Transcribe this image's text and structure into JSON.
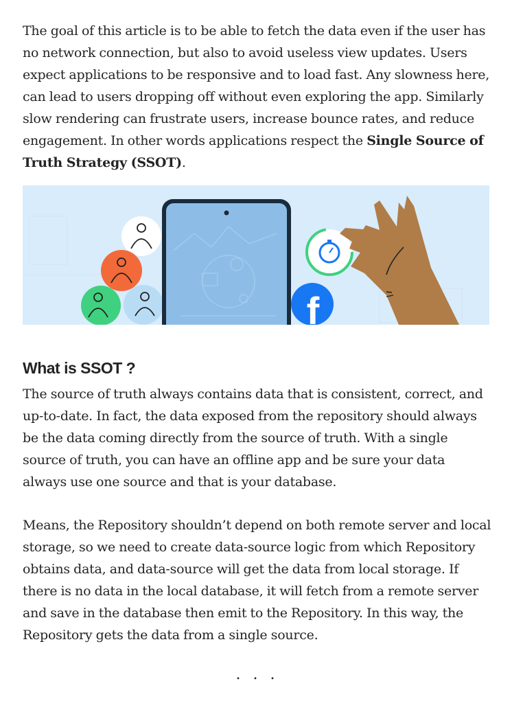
{
  "intro": {
    "text_before": "The goal of this article is to be able to fetch the data even if the user has no network connection, but also to avoid useless view updates. Users expect applications to be responsive and to load fast. Any slowness here, can lead to users dropping off without even exploring the app. Similarly slow rendering can frustrate users, increase bounce rates, and reduce engagement. In other words applications respect the ",
    "bold": "Single Source of Truth Strategy (SSOT)",
    "text_after": "."
  },
  "hero_image": {
    "brand_mark": "f",
    "colors": {
      "background": "#d8ecfb",
      "phone_screen": "#8dbde6",
      "facebook": "#1877f2",
      "hand": "#b07c47"
    }
  },
  "heading": "What is SSOT ?",
  "paragraph1": "The source of truth always contains data that is consistent, correct, and up-to-date. In fact, the data exposed from the repository should always be the data coming directly from the source of truth. With a single source of truth, you can have an offline app and be sure your data always use one source and that is your database.",
  "paragraph2": "Means, the Repository shouldn’t depend on both remote server and local storage, so we need to create data-source logic from which Repository obtains data, and data-source will get the data from local storage. If there is no data in the local database, it will fetch from a remote server and save in the database then emit to the Repository. In this way, the Repository gets the data from a single source.",
  "separator": "..."
}
